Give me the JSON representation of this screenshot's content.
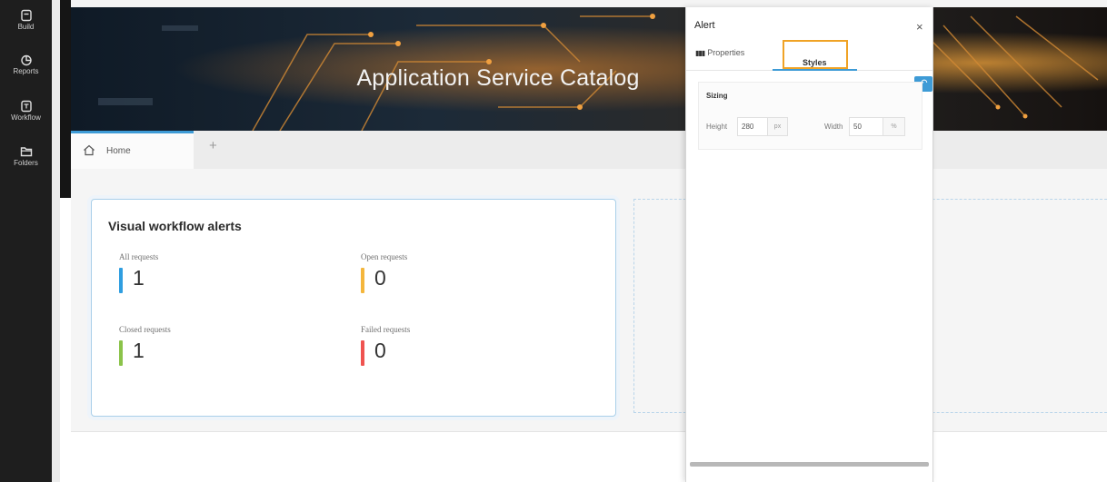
{
  "nav": {
    "items": [
      {
        "label": "Build",
        "icon": "build-icon"
      },
      {
        "label": "Reports",
        "icon": "reports-icon"
      },
      {
        "label": "Workflow",
        "icon": "workflow-icon"
      },
      {
        "label": "Folders",
        "icon": "folder-icon"
      }
    ]
  },
  "banner": {
    "title": "Application Service Catalog"
  },
  "tabs": {
    "home_label": "Home",
    "add_label": "+"
  },
  "widget": {
    "title": "Visual workflow alerts",
    "metrics": [
      {
        "label": "All requests",
        "value": "1",
        "color": "#2f9ee0"
      },
      {
        "label": "Open requests",
        "value": "0",
        "color": "#f4b63c"
      },
      {
        "label": "Closed requests",
        "value": "1",
        "color": "#8bc34a"
      },
      {
        "label": "Failed requests",
        "value": "0",
        "color": "#ef5350"
      }
    ]
  },
  "panel": {
    "title": "Alert",
    "close": "×",
    "tabs": {
      "properties": "Properties",
      "styles": "Styles"
    },
    "undo": "↶",
    "sizing": {
      "title": "Sizing",
      "height_label": "Height",
      "height_value": "280",
      "height_unit": "px",
      "width_label": "Width",
      "width_value": "50",
      "width_unit": "%"
    }
  },
  "colors": {
    "accent": "#3e9bd6",
    "highlight": "#f0a326",
    "nav_bg": "#1e1e1e"
  }
}
